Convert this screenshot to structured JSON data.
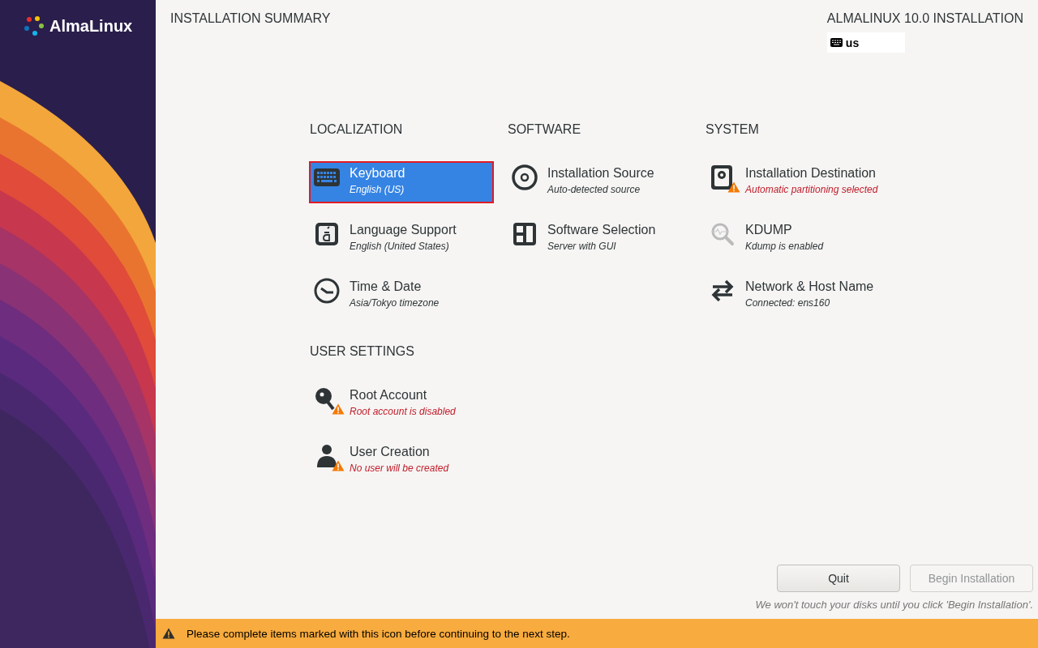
{
  "sidebar": {
    "logo_text": "AlmaLinux"
  },
  "header": {
    "title": "INSTALLATION SUMMARY",
    "product": "ALMALINUX 10.0 INSTALLATION",
    "keyboard_layout": "us"
  },
  "sections": [
    {
      "title": "LOCALIZATION",
      "items": [
        {
          "kind": "keyboard",
          "title": "Keyboard",
          "status": "English (US)",
          "selected": true,
          "warning": false
        },
        {
          "kind": "language",
          "title": "Language Support",
          "status": "English (United States)",
          "selected": false,
          "warning": false
        },
        {
          "kind": "clock",
          "title": "Time & Date",
          "status": "Asia/Tokyo timezone",
          "selected": false,
          "warning": false
        }
      ]
    },
    {
      "title": "SOFTWARE",
      "items": [
        {
          "kind": "disc",
          "title": "Installation Source",
          "status": "Auto-detected source",
          "selected": false,
          "warning": false
        },
        {
          "kind": "package",
          "title": "Software Selection",
          "status": "Server with GUI",
          "selected": false,
          "warning": false
        }
      ]
    },
    {
      "title": "SYSTEM",
      "items": [
        {
          "kind": "drive",
          "title": "Installation Destination",
          "status": "Automatic partitioning selected",
          "selected": false,
          "warning": true
        },
        {
          "kind": "magnifier",
          "title": "KDUMP",
          "status": "Kdump is enabled",
          "selected": false,
          "warning": false
        },
        {
          "kind": "network",
          "title": "Network & Host Name",
          "status": "Connected: ens160",
          "selected": false,
          "warning": false
        }
      ]
    },
    {
      "title": "USER SETTINGS",
      "items": [
        {
          "kind": "key",
          "title": "Root Account",
          "status": "Root account is disabled",
          "selected": false,
          "warning": true
        },
        {
          "kind": "user",
          "title": "User Creation",
          "status": "No user will be created",
          "selected": false,
          "warning": true
        }
      ]
    }
  ],
  "buttons": [
    {
      "label": "Quit",
      "disabled": false
    },
    {
      "label": "Begin Installation",
      "disabled": true
    }
  ],
  "note": "We won't touch your disks until you click 'Begin Installation'.",
  "warning_bar": {
    "text": "Please complete items marked with this icon before continuing to the next step."
  }
}
